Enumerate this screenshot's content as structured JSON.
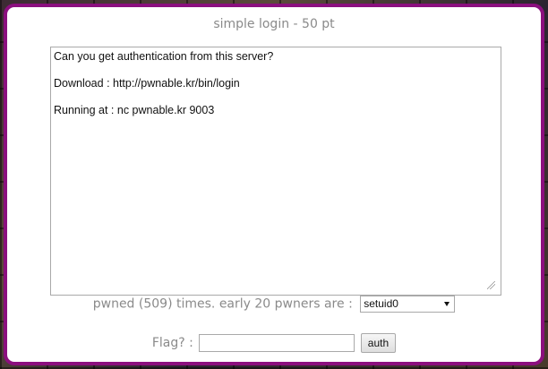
{
  "challenge": {
    "title": "simple login - 50 pt",
    "description": "Can you get authentication from this server?\n\nDownload : http://pwnable.kr/bin/login\n\nRunning at : nc pwnable.kr 9003"
  },
  "pwners": {
    "label": "pwned (509) times. early 20 pwners are :",
    "selected": "setuid0"
  },
  "flag": {
    "label": "Flag? :",
    "value": "",
    "button_label": "auth"
  },
  "colors": {
    "border_accent": "#8b0f7e",
    "muted_text": "#8a8a8a"
  }
}
